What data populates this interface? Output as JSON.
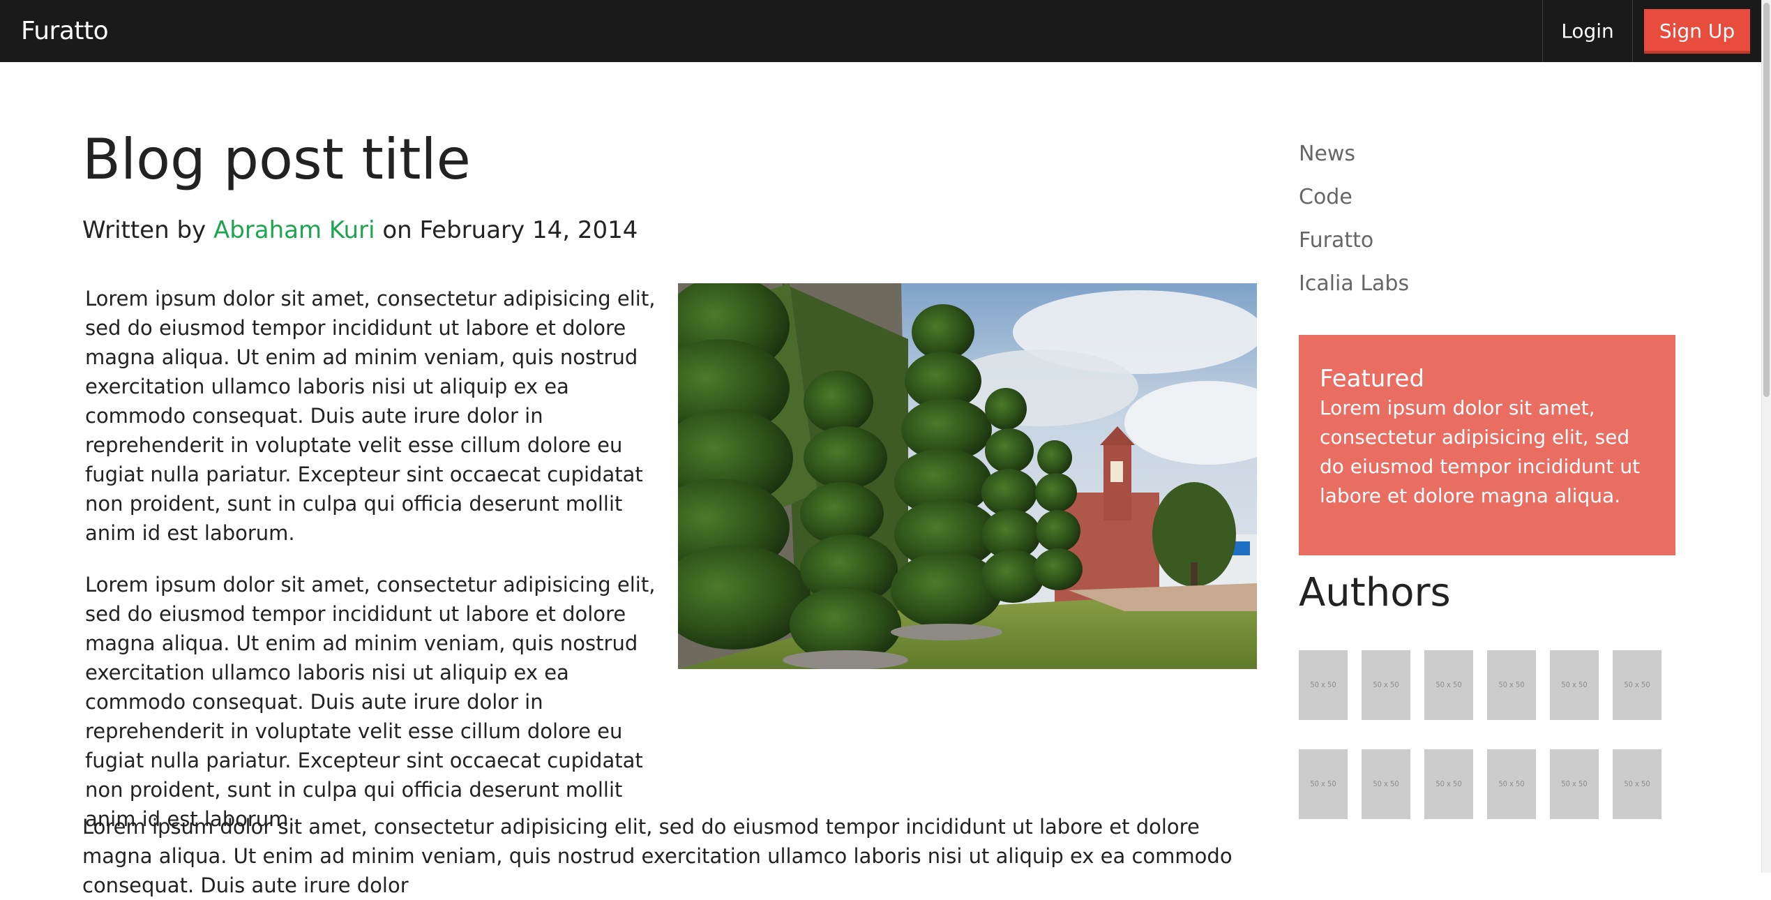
{
  "navbar": {
    "brand": "Furatto",
    "login_label": "Login",
    "signup_label": "Sign Up"
  },
  "post": {
    "title": "Blog post title",
    "byline_prefix": "Written by ",
    "author": "Abraham Kuri",
    "byline_suffix": " on February 14, 2014",
    "paragraphs": [
      "Lorem ipsum dolor sit amet, consectetur adipisicing elit, sed do eiusmod tempor incididunt ut labore et dolore magna aliqua. Ut enim ad minim veniam, quis nostrud exercitation ullamco laboris nisi ut aliquip ex ea commodo consequat. Duis aute irure dolor in reprehenderit in voluptate velit esse cillum dolore eu fugiat nulla pariatur. Excepteur sint occaecat cupidatat non proident, sunt in culpa qui officia deserunt mollit anim id est laborum.",
      "Lorem ipsum dolor sit amet, consectetur adipisicing elit, sed do eiusmod tempor incididunt ut labore et dolore magna aliqua. Ut enim ad minim veniam, quis nostrud exercitation ullamco laboris nisi ut aliquip ex ea commodo consequat. Duis aute irure dolor in reprehenderit in voluptate velit esse cillum dolore eu fugiat nulla pariatur. Excepteur sint occaecat cupidatat non proident, sunt in culpa qui officia deserunt mollit anim id est laborum."
    ],
    "full_paragraph": "Lorem ipsum dolor sit amet, consectetur adipisicing elit, sed do eiusmod tempor incididunt ut labore et dolore magna aliqua. Ut enim ad minim veniam, quis nostrud exercitation ullamco laboris nisi ut aliquip ex ea commodo consequat. Duis aute irure dolor"
  },
  "sidebar": {
    "nav_items": [
      "News",
      "Code",
      "Furatto",
      "Icalia Labs"
    ],
    "featured": {
      "title": "Featured",
      "text": "Lorem ipsum dolor sit amet, consectetur adipisicing elit, sed do eiusmod tempor incididunt ut labore et dolore magna aliqua."
    },
    "authors_heading": "Authors",
    "author_placeholders": [
      "50 x 50",
      "50 x 50",
      "50 x 50",
      "50 x 50",
      "50 x 50",
      "50 x 50",
      "50 x 50",
      "50 x 50",
      "50 x 50",
      "50 x 50",
      "50 x 50",
      "50 x 50"
    ]
  },
  "colors": {
    "navbar_bg": "#1a1a1a",
    "signup_bg": "#e74c3c",
    "author_link": "#1ca54e",
    "featured_bg": "#ea6d62",
    "placeholder_bg": "#cccccc"
  }
}
